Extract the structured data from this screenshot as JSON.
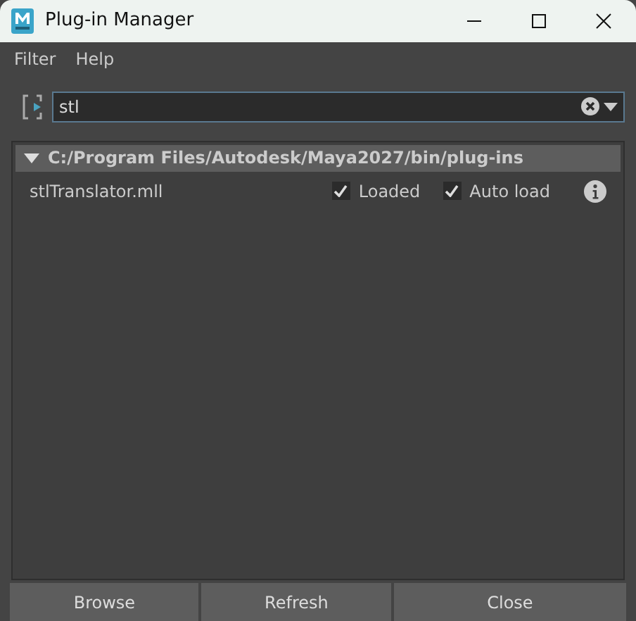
{
  "window": {
    "title": "Plug-in Manager"
  },
  "menu": [
    "Filter",
    "Help"
  ],
  "search": {
    "value": "stl"
  },
  "group": {
    "path": "C:/Program Files/Autodesk/Maya2027/bin/plug-ins",
    "expanded": true,
    "plugins": [
      {
        "name": "stlTranslator.mll",
        "loaded": {
          "label": "Loaded",
          "checked": true
        },
        "auto_load": {
          "label": "Auto load",
          "checked": true
        }
      }
    ]
  },
  "buttons": [
    "Browse",
    "Refresh",
    "Close"
  ]
}
